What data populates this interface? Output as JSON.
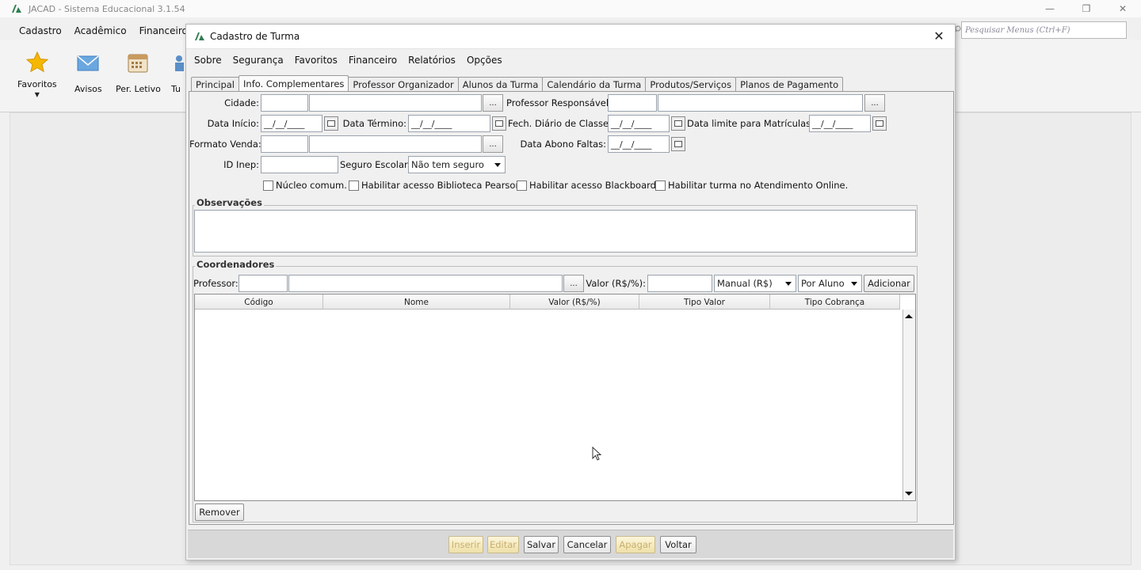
{
  "app": {
    "title": "JACAD - Sistema Educacional 3.1.54",
    "menu": [
      "Cadastro",
      "Acadêmico",
      "Financeiro"
    ],
    "search_placeholder": "Pesquisar Menus (Ctrl+F)",
    "toolbar": [
      {
        "label": "Favoritos",
        "icon": "star-icon"
      },
      {
        "label": "Avisos",
        "icon": "mail-icon"
      },
      {
        "label": "Per. Letivo",
        "icon": "calendar-icon"
      },
      {
        "label": "Tu",
        "icon": "people-icon"
      }
    ]
  },
  "dialog": {
    "title": "Cadastro de Turma",
    "menu": [
      "Sobre",
      "Segurança",
      "Favoritos",
      "Financeiro",
      "Relatórios",
      "Opções"
    ],
    "tabs": [
      "Principal",
      "Info. Complementares",
      "Professor Organizador",
      "Alunos da Turma",
      "Calendário da Turma",
      "Produtos/Serviços",
      "Planos de Pagamento"
    ],
    "active_tab": "Info. Complementares",
    "form": {
      "cidade_label": "Cidade:",
      "professor_responsavel_label": "Professor Responsável:",
      "data_inicio_label": "Data Início:",
      "data_inicio_value": "__/__/____",
      "data_termino_label": "Data Término:",
      "data_termino_value": "__/__/____",
      "fech_diario_label": "Fech. Diário de Classe:",
      "fech_diario_value": "__/__/____",
      "data_limite_label": "Data limite para Matrículas:",
      "data_limite_value": "__/__/____",
      "formato_venda_label": "Formato Venda:",
      "data_abono_label": "Data Abono Faltas:",
      "data_abono_value": "__/__/____",
      "id_inep_label": "ID Inep:",
      "seguro_escolar_label": "Seguro Escolar:",
      "seguro_escolar_value": "Não tem seguro",
      "checkboxes": [
        "Núcleo comum.",
        "Habilitar acesso Biblioteca Pearson.",
        "Habilitar acesso Blackboard.",
        "Habilitar turma no Atendimento Online."
      ],
      "dots": "..."
    },
    "observacoes_title": "Observações",
    "coordenadores": {
      "title": "Coordenadores",
      "professor_label": "Professor:",
      "valor_label": "Valor (R$/%):",
      "tipo_valor_value": "Manual (R$)",
      "tipo_cobranca_value": "Por Aluno",
      "adicionar": "Adicionar",
      "remover": "Remover",
      "columns": [
        "Código",
        "Nome",
        "Valor (R$/%)",
        "Tipo Valor",
        "Tipo Cobrança"
      ]
    },
    "actions": [
      "Inserir",
      "Editar",
      "Salvar",
      "Cancelar",
      "Apagar",
      "Voltar"
    ]
  }
}
